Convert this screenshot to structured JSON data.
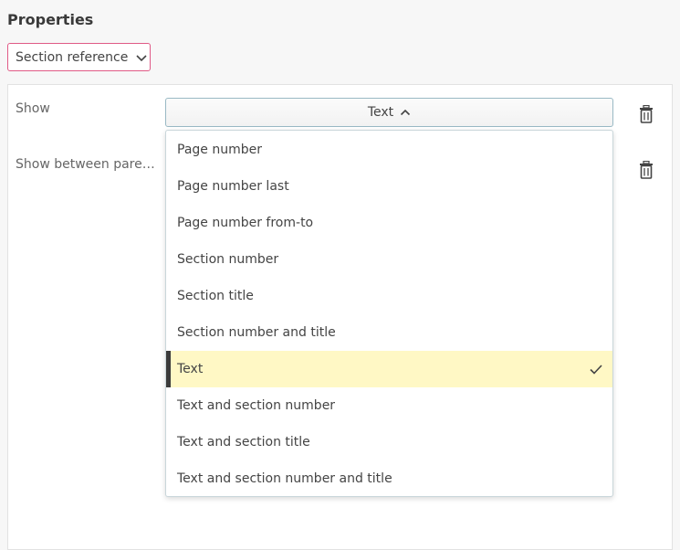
{
  "header": {
    "title": "Properties"
  },
  "section_select": {
    "value": "Section reference"
  },
  "rows": [
    {
      "label": "Show"
    },
    {
      "label": "Show between parent..."
    }
  ],
  "show_select": {
    "value": "Text"
  },
  "dropdown": {
    "options": [
      {
        "label": "Page number"
      },
      {
        "label": "Page number last"
      },
      {
        "label": "Page number from-to"
      },
      {
        "label": "Section number"
      },
      {
        "label": "Section title"
      },
      {
        "label": "Section number and title"
      },
      {
        "label": "Text"
      },
      {
        "label": "Text and section number"
      },
      {
        "label": "Text and section title"
      },
      {
        "label": "Text and section number and title"
      }
    ],
    "selected": "Text"
  },
  "icons": {
    "chevron_down": "chevron-down-icon",
    "chevron_up": "chevron-up-icon",
    "trash": "trash-icon",
    "check": "check-icon"
  },
  "colors": {
    "accent_border": "#e05a86",
    "selected_bg": "#fff8c5",
    "selected_marker": "#3a3a3a",
    "focus_border": "#99b9c4"
  }
}
